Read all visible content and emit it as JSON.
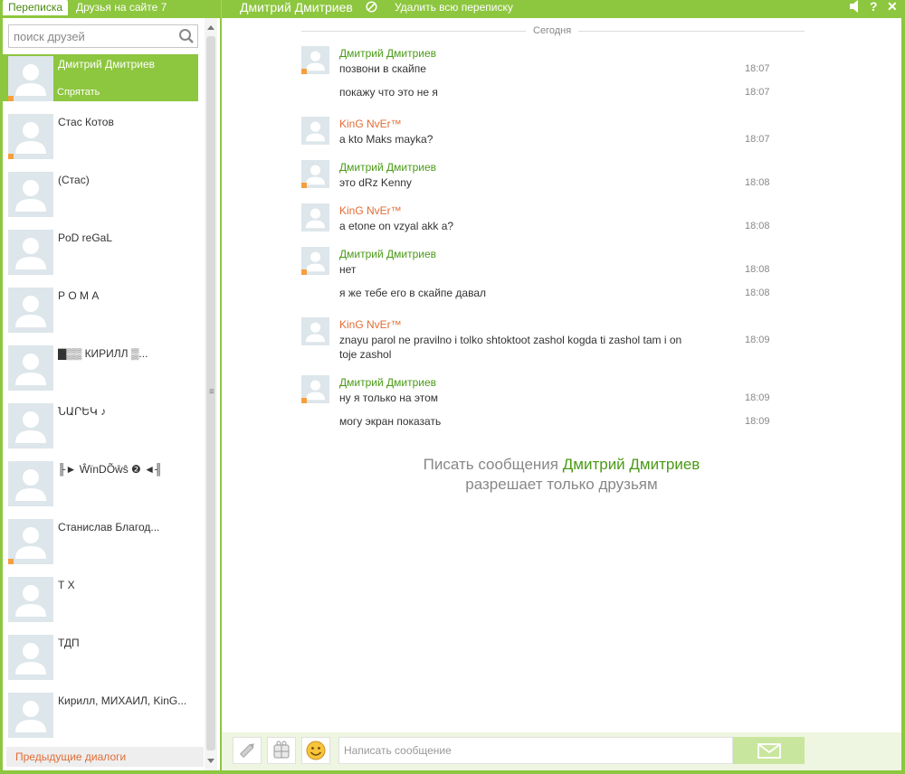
{
  "topbar": {
    "tab_messages": "Переписка",
    "tab_friends": "Друзья на сайте 7",
    "chat_title": "Дмитрий Дмитриев",
    "delete_all": "Удалить всю переписку",
    "icons": [
      "sound-icon",
      "help-icon",
      "close-icon"
    ]
  },
  "search": {
    "placeholder": "поиск друзей"
  },
  "friends": [
    {
      "name": "Дмитрий Дмитриев",
      "action": "Спрятать",
      "online": true,
      "active": true
    },
    {
      "name": "Стас Котов",
      "online": true
    },
    {
      "name": "(Стас)",
      "online": false
    },
    {
      "name": "PoD reGaL",
      "online": false
    },
    {
      "name": "Р О М А",
      "online": false
    },
    {
      "name": "▇▒▒ КИРИЛЛ ▒...",
      "online": false
    },
    {
      "name": "ՆԱՐԵԿ ♪",
      "online": false
    },
    {
      "name": "╟► ŴïnDÕŵŝ ❷ ◄╢",
      "online": false
    },
    {
      "name": "Станислав Благод...",
      "online": true
    },
    {
      "name": "Т Х",
      "online": false
    },
    {
      "name": "ТДП",
      "online": false
    },
    {
      "name": "Кирилл, МИХАИЛ, KinG...",
      "online": false
    }
  ],
  "prev_dialogs": "Предыдущие диалоги",
  "chat": {
    "day_label": "Сегодня",
    "messages": [
      {
        "author": "Дмитрий Дмитриев",
        "text": "позвони в скайпе",
        "time": "18:07"
      },
      {
        "author": "",
        "text": "покажу что это не я",
        "time": "18:07"
      },
      {
        "author": "KinG NvEr™",
        "text": "a kto  Maks mayka?",
        "time": "18:07"
      },
      {
        "author": "Дмитрий Дмитриев",
        "text": "это dRz Kenny",
        "time": "18:08"
      },
      {
        "author": "KinG NvEr™",
        "text": "a etone on  vzyal akk a?",
        "time": "18:08"
      },
      {
        "author": "Дмитрий Дмитриев",
        "text": "нет",
        "time": "18:08"
      },
      {
        "author": "",
        "text": "я же тебе его в скайпе давал",
        "time": "18:08"
      },
      {
        "author": "KinG NvEr™",
        "text": "znayu parol ne pravilno i tolko shtoktoot zashol kogda ti zashol tam i on toje zashol",
        "time": "18:09"
      },
      {
        "author": "Дмитрий Дмитриев",
        "text": "ну я только на этом",
        "time": "18:09"
      },
      {
        "author": "",
        "text": "могу экран показать",
        "time": "18:09"
      }
    ],
    "notice_prefix": "Писать сообщения",
    "notice_name": "Дмитрий Дмитриев",
    "notice_suffix": "разрешает только друзьям"
  },
  "input": {
    "placeholder": "Написать сообщение"
  },
  "colors": {
    "accent": "#8dc63f",
    "name_green": "#4a9a16",
    "name_orange": "#e06d35",
    "online": "#f79f3d"
  }
}
